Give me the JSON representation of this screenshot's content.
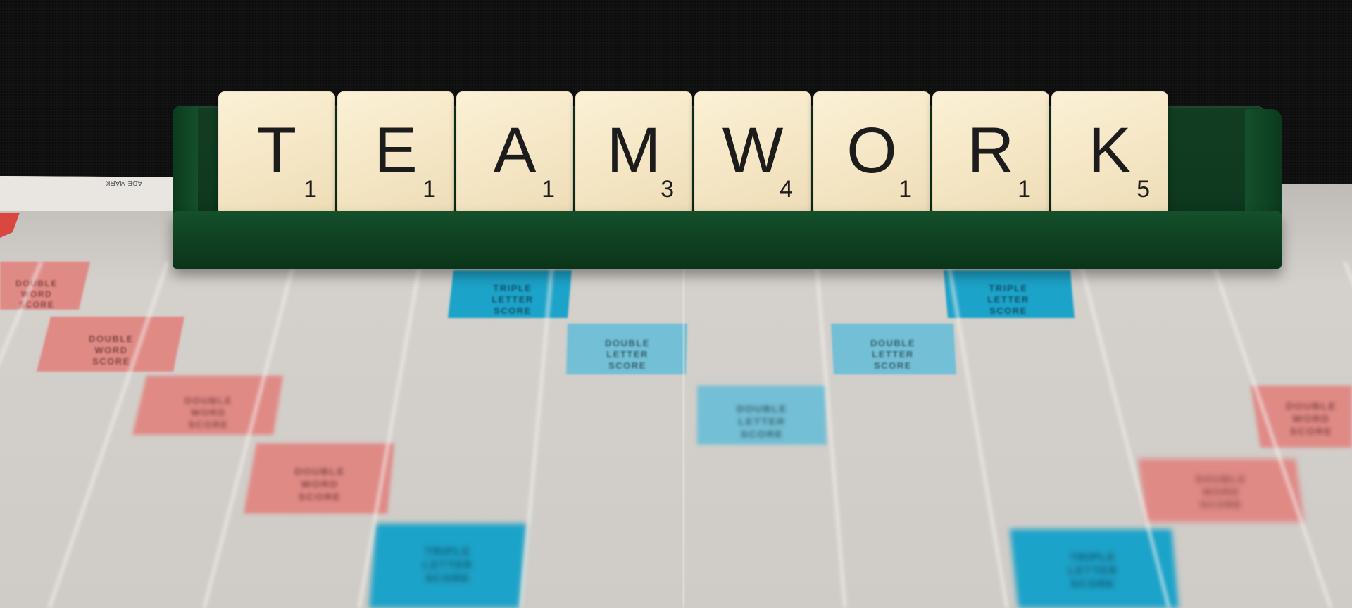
{
  "word": "TEAMWORK",
  "tiles": [
    {
      "letter": "T",
      "points": "1"
    },
    {
      "letter": "E",
      "points": "1"
    },
    {
      "letter": "A",
      "points": "1"
    },
    {
      "letter": "M",
      "points": "3"
    },
    {
      "letter": "W",
      "points": "4"
    },
    {
      "letter": "O",
      "points": "1"
    },
    {
      "letter": "R",
      "points": "1"
    },
    {
      "letter": "K",
      "points": "5"
    }
  ],
  "premium_labels": {
    "double_word": [
      "DOUBLE",
      "WORD",
      "SCORE"
    ],
    "double_letter": [
      "DOUBLE",
      "LETTER",
      "SCORE"
    ],
    "triple_letter": [
      "TRIPLE",
      "LETTER",
      "SCORE"
    ],
    "double_word_alt": [
      "DOUBLE",
      "WORD",
      "SCORE"
    ]
  },
  "board_edge_text": "ADE MARK",
  "colors": {
    "rack": "#0f3f21",
    "tile": "#f4e5c3",
    "board": "#d6d2cd",
    "grid_line": "#f4f2ef",
    "double_word": "#e08a86",
    "double_letter": "#73bfd6",
    "triple_letter": "#1fa3c9",
    "backdrop": "#0c0c0c"
  }
}
